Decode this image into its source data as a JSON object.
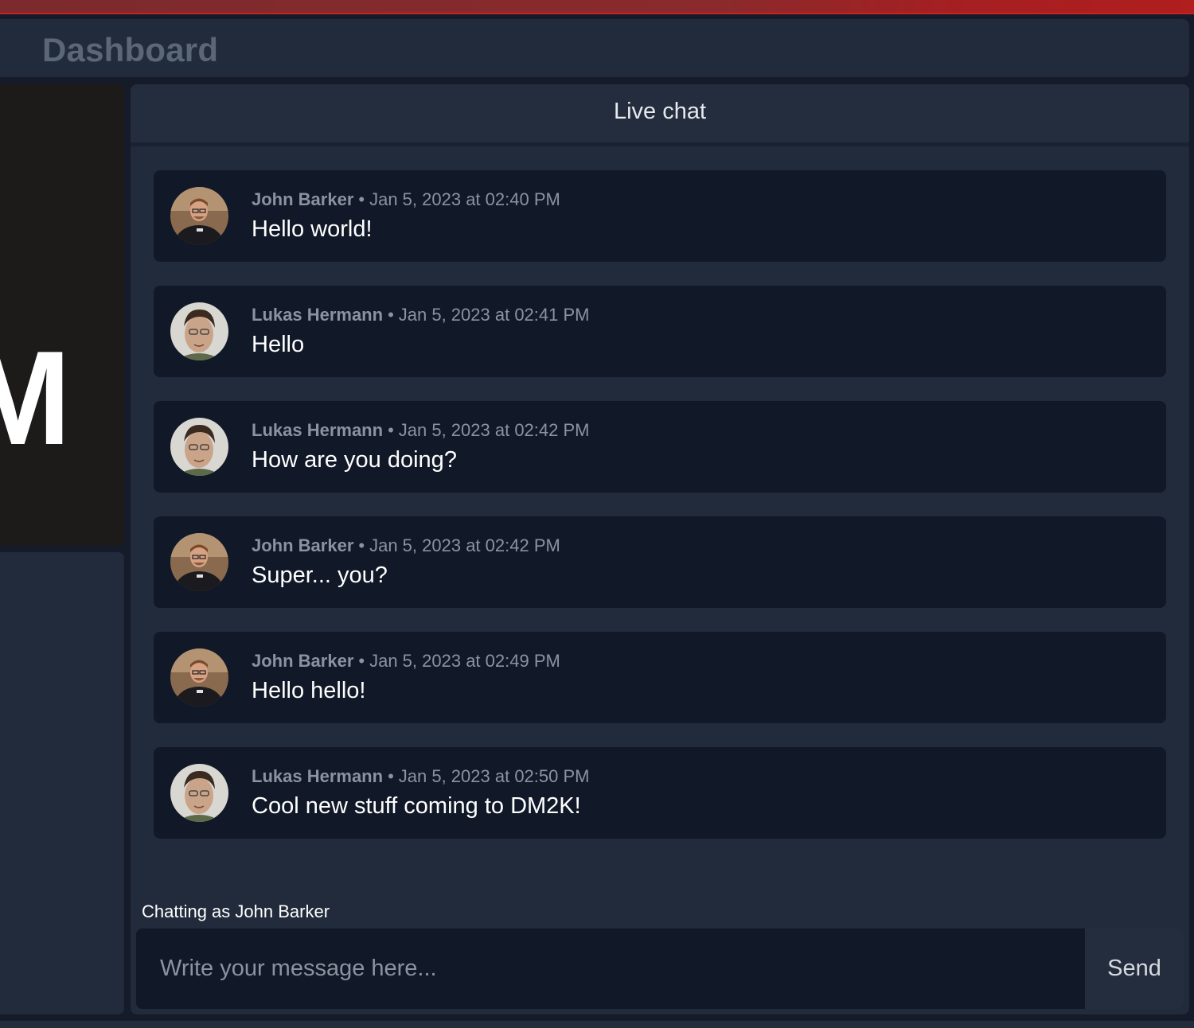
{
  "header": {
    "title": "Dashboard"
  },
  "left_panel": {
    "logo_letter": "M"
  },
  "chat": {
    "title": "Live chat",
    "separator": "•",
    "messages": [
      {
        "author": "John Barker",
        "timestamp": "Jan 5, 2023 at 02:40 PM",
        "text": "Hello world!",
        "avatar": "john-barker-avatar"
      },
      {
        "author": "Lukas Hermann",
        "timestamp": "Jan 5, 2023 at 02:41 PM",
        "text": "Hello",
        "avatar": "lukas-hermann-avatar"
      },
      {
        "author": "Lukas Hermann",
        "timestamp": "Jan 5, 2023 at 02:42 PM",
        "text": "How are you doing?",
        "avatar": "lukas-hermann-avatar"
      },
      {
        "author": "John Barker",
        "timestamp": "Jan 5, 2023 at 02:42 PM",
        "text": "Super... you?",
        "avatar": "john-barker-avatar"
      },
      {
        "author": "John Barker",
        "timestamp": "Jan 5, 2023 at 02:49 PM",
        "text": "Hello hello!",
        "avatar": "john-barker-avatar"
      },
      {
        "author": "Lukas Hermann",
        "timestamp": "Jan 5, 2023 at 02:50 PM",
        "text": "Cool new stuff coming to DM2K!",
        "avatar": "lukas-hermann-avatar"
      }
    ],
    "chatting_as": "Chatting as John Barker",
    "input": {
      "value": "",
      "placeholder": "Write your message here..."
    },
    "send_label": "Send"
  },
  "colors": {
    "accent_bar": "#b01e1e",
    "panel_bg": "#222b3b",
    "message_bg": "#111827",
    "muted_text": "#8b93a1"
  }
}
